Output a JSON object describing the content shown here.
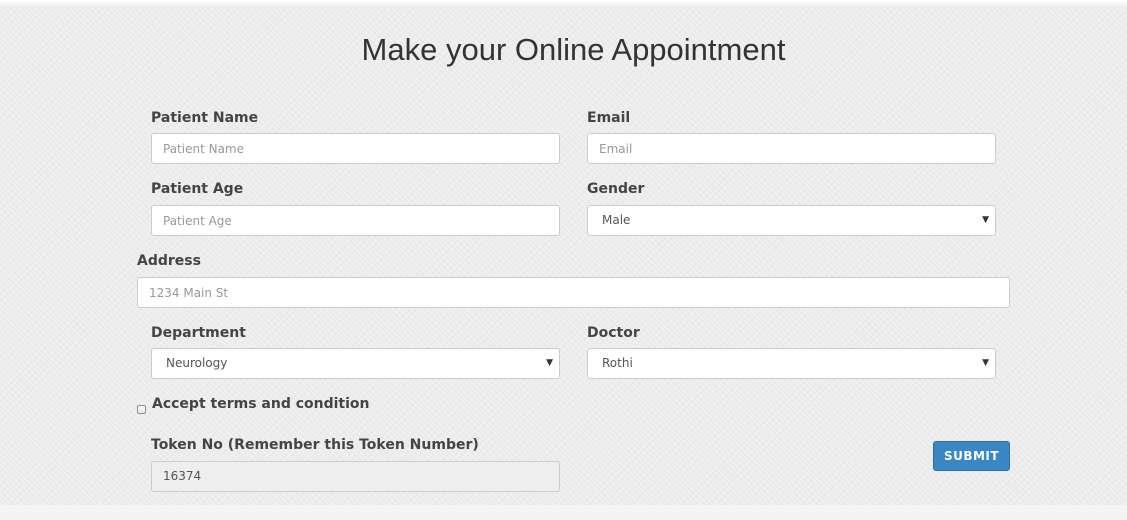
{
  "form": {
    "title": "Make your Online Appointment",
    "patient_name": {
      "label": "Patient Name",
      "placeholder": "Patient Name",
      "value": ""
    },
    "email": {
      "label": "Email",
      "placeholder": "Email",
      "value": ""
    },
    "patient_age": {
      "label": "Patient Age",
      "placeholder": "Patient Age",
      "value": ""
    },
    "gender": {
      "label": "Gender",
      "selected": "Male"
    },
    "address": {
      "label": "Address",
      "placeholder": "1234 Main St",
      "value": ""
    },
    "department": {
      "label": "Department",
      "selected": "Neurology"
    },
    "doctor": {
      "label": "Doctor",
      "selected": "Rothi"
    },
    "terms": {
      "label": "Accept terms and condition",
      "checked": false
    },
    "token": {
      "label": "Token No (Remember this Token Number)",
      "value": "16374"
    },
    "submit_label": "SUBMIT"
  },
  "icons": {
    "select_caret": "chevron-down-icon",
    "caret_glyph": "▼"
  },
  "colors": {
    "submit_button": "#3a87c8",
    "page_background": "#ececec",
    "readonly_field": "#eeeeee"
  }
}
